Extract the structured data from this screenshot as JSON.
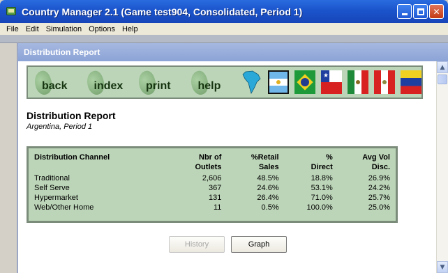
{
  "window": {
    "title": "Country Manager 2.1 (Game test904, Consolidated, Period 1)"
  },
  "menu": [
    "File",
    "Edit",
    "Simulation",
    "Options",
    "Help"
  ],
  "inner_window": {
    "title": "Distribution Report"
  },
  "nav": {
    "back": "back",
    "index": "index",
    "print": "print",
    "help": "help",
    "flags": [
      "south-america-map",
      "argentina",
      "brazil",
      "chile",
      "mexico",
      "peru",
      "venezuela"
    ]
  },
  "report": {
    "title": "Distribution Report",
    "subtitle": "Argentina, Period 1"
  },
  "table": {
    "headers": [
      "Distribution Channel",
      "Nbr of\nOutlets",
      "%Retail\nSales",
      "%\nDirect",
      "Avg Vol\nDisc."
    ],
    "rows": [
      [
        "Traditional",
        "2,606",
        "48.5%",
        "18.8%",
        "26.9%"
      ],
      [
        "Self Serve",
        "367",
        "24.6%",
        "53.1%",
        "24.2%"
      ],
      [
        "Hypermarket",
        "131",
        "26.4%",
        "71.0%",
        "25.7%"
      ],
      [
        "Web/Other Home",
        "11",
        "0.5%",
        "100.0%",
        "25.0%"
      ]
    ]
  },
  "buttons": {
    "history": "History",
    "graph": "Graph"
  }
}
